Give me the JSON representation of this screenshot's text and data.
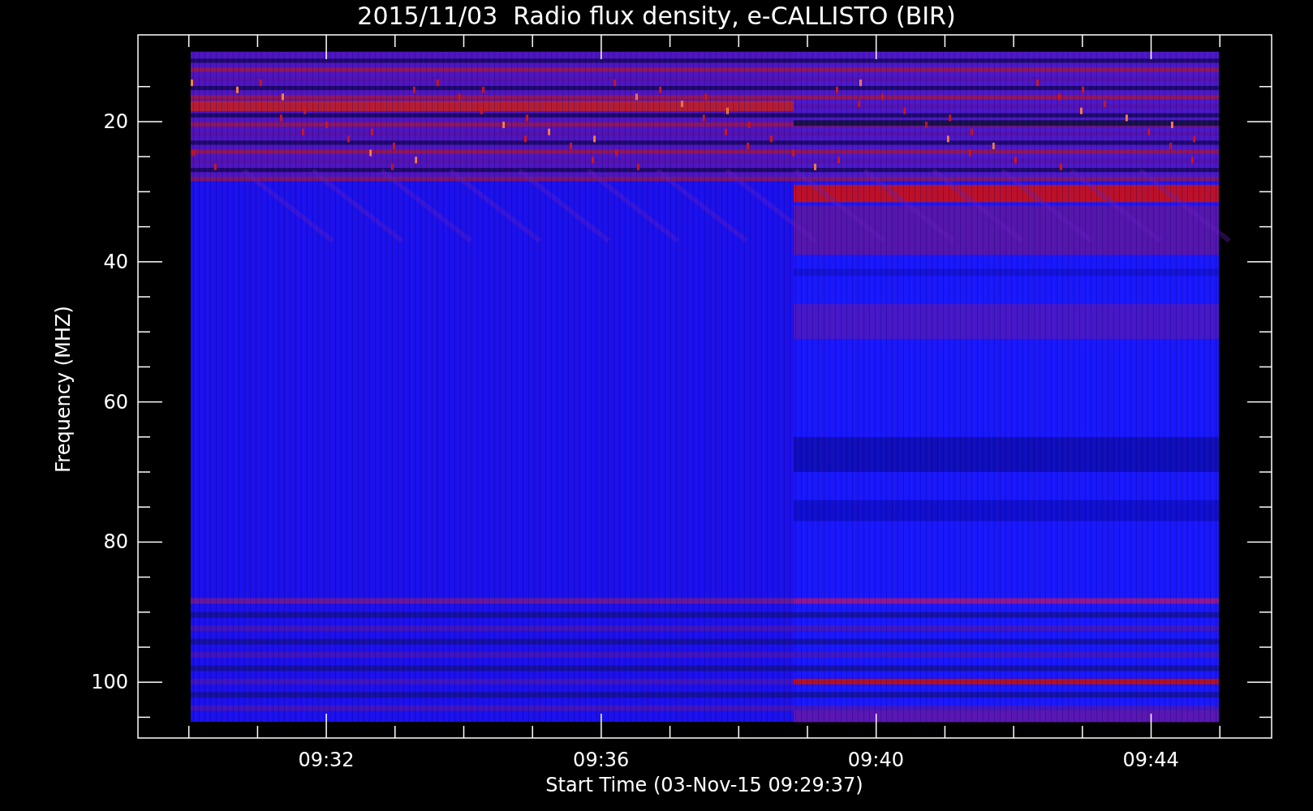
{
  "title": "2015/11/03  Radio flux density, e-CALLISTO (BIR)",
  "ylabel": "Frequency (MHZ)",
  "xlabel": "Start Time (03-Nov-15 09:29:37)",
  "yticks": [
    "20",
    "40",
    "60",
    "80",
    "100"
  ],
  "xticks": [
    "09:32",
    "09:36",
    "09:40",
    "09:44"
  ]
}
